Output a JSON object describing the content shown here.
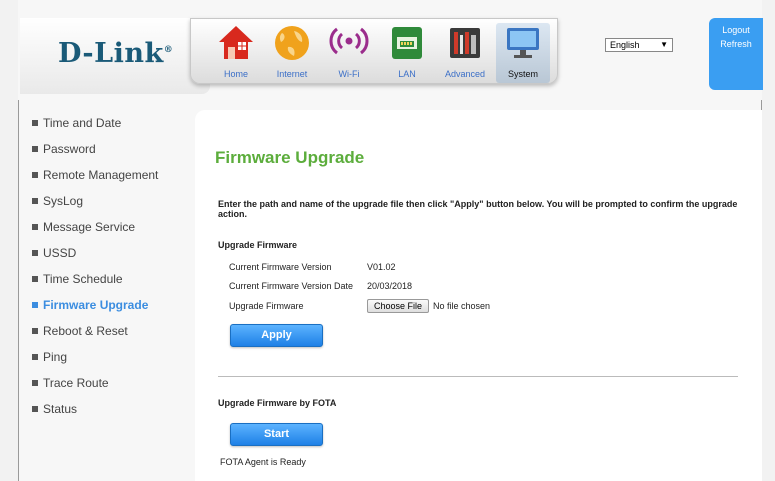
{
  "brand": {
    "logo_text": "D-Link",
    "logo_mark": "®"
  },
  "nav": {
    "items": [
      {
        "label": "Home",
        "icon": "home-icon"
      },
      {
        "label": "Internet",
        "icon": "globe-icon"
      },
      {
        "label": "Wi-Fi",
        "icon": "wifi-icon"
      },
      {
        "label": "LAN",
        "icon": "lan-icon"
      },
      {
        "label": "Advanced",
        "icon": "tools-icon"
      },
      {
        "label": "System",
        "icon": "monitor-icon"
      }
    ],
    "active": "System"
  },
  "language": {
    "selected": "English"
  },
  "account": {
    "logout_label": "Logout",
    "refresh_label": "Refresh"
  },
  "sidebar": {
    "items": [
      {
        "label": "Time and Date"
      },
      {
        "label": "Password"
      },
      {
        "label": "Remote Management"
      },
      {
        "label": "SysLog"
      },
      {
        "label": "Message Service"
      },
      {
        "label": "USSD"
      },
      {
        "label": "Time Schedule"
      },
      {
        "label": "Firmware Upgrade"
      },
      {
        "label": "Reboot & Reset"
      },
      {
        "label": "Ping"
      },
      {
        "label": "Trace Route"
      },
      {
        "label": "Status"
      }
    ],
    "active": "Firmware Upgrade"
  },
  "main": {
    "title": "Firmware Upgrade",
    "intro": "Enter the path and name of the upgrade file then click \"Apply\" button below. You will be prompted to confirm the upgrade action.",
    "upgrade_section": {
      "heading": "Upgrade Firmware",
      "current_version_label": "Current Firmware Version",
      "current_version_value": "V01.02",
      "current_date_label": "Current Firmware Version Date",
      "current_date_value": "20/03/2018",
      "upgrade_label": "Upgrade Firmware",
      "choose_file_label": "Choose File",
      "no_file_text": "No file chosen",
      "apply_label": "Apply"
    },
    "fota_section": {
      "heading": "Upgrade Firmware by FOTA",
      "start_label": "Start",
      "status_text": "FOTA Agent is Ready"
    }
  },
  "colors": {
    "accent_blue": "#3a9ef2",
    "title_green": "#5cad3c",
    "logo_blue": "#1a5a78",
    "active_link": "#3b8de0"
  }
}
